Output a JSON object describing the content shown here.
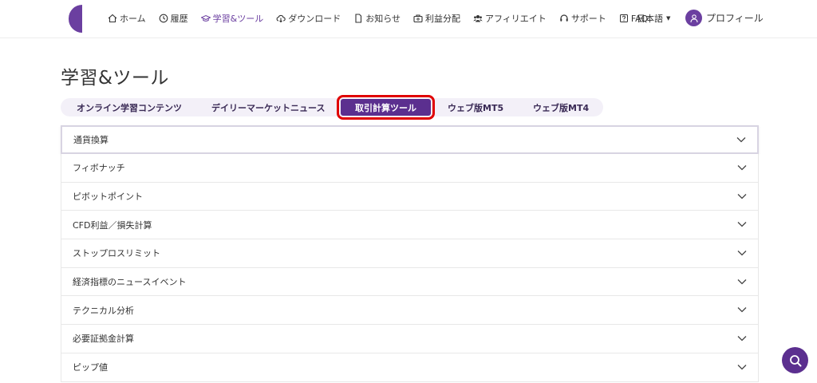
{
  "header": {
    "nav": [
      {
        "label": "ホーム",
        "icon": "home-icon"
      },
      {
        "label": "履歴",
        "icon": "clock-icon"
      },
      {
        "label": "学習&ツール",
        "icon": "graduation-cap-icon",
        "active": true
      },
      {
        "label": "ダウンロード",
        "icon": "cloud-download-icon"
      },
      {
        "label": "お知らせ",
        "icon": "document-icon"
      },
      {
        "label": "利益分配",
        "icon": "briefcase-icon"
      },
      {
        "label": "アフィリエイト",
        "icon": "users-icon"
      },
      {
        "label": "サポート",
        "icon": "headset-icon"
      },
      {
        "label": "FAQ",
        "icon": "question-icon"
      }
    ],
    "language": "日本語",
    "profile": "プロフィール"
  },
  "page": {
    "title": "学習&ツール"
  },
  "tabs": [
    {
      "label": "オンライン学習コンテンツ"
    },
    {
      "label": "デイリーマーケットニュース"
    },
    {
      "label": "取引計算ツール",
      "active": true
    },
    {
      "label": "ウェブ版MT5"
    },
    {
      "label": "ウェブ版MT4"
    }
  ],
  "accordion": [
    {
      "label": "通貨換算"
    },
    {
      "label": "フィボナッチ"
    },
    {
      "label": "ピボットポイント"
    },
    {
      "label": "CFD利益／損失計算"
    },
    {
      "label": "ストップロスリミット"
    },
    {
      "label": "経済指標のニュースイベント"
    },
    {
      "label": "テクニカル分析"
    },
    {
      "label": "必要証拠金計算"
    },
    {
      "label": "ピップ値"
    }
  ],
  "colors": {
    "accent": "#5b2f8f",
    "highlight": "#e00000"
  }
}
